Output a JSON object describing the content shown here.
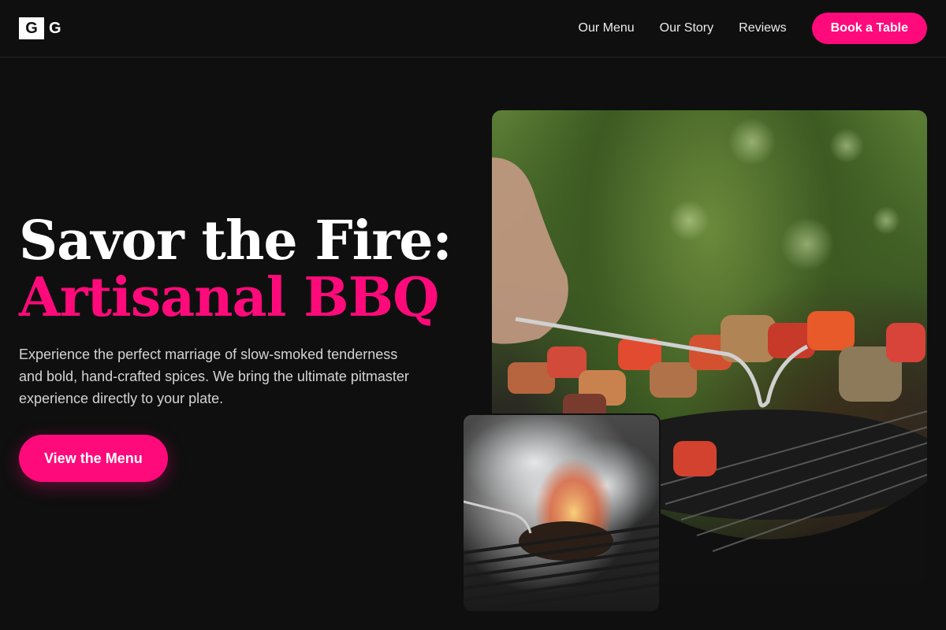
{
  "logo": {
    "letter1": "G",
    "letter2": "G"
  },
  "nav": {
    "items": [
      {
        "label": "Our Menu"
      },
      {
        "label": "Our Story"
      },
      {
        "label": "Reviews"
      }
    ],
    "cta_label": "Book a Table"
  },
  "hero": {
    "title_line1": "Savor the Fire:",
    "title_line2": "Artisanal BBQ",
    "description": "Experience the perfect marriage of slow-smoked tenderness and bold, hand-crafted spices. We bring the ultimate pitmaster experience directly to your plate.",
    "cta_label": "View the Menu"
  },
  "images": {
    "main": "skewers-on-grill-photo",
    "inset": "smoking-grill-photo"
  },
  "colors": {
    "accent": "#ff0a7a",
    "background": "#0f0f0f",
    "text": "#ffffff",
    "muted_text": "#d4d4d4"
  }
}
